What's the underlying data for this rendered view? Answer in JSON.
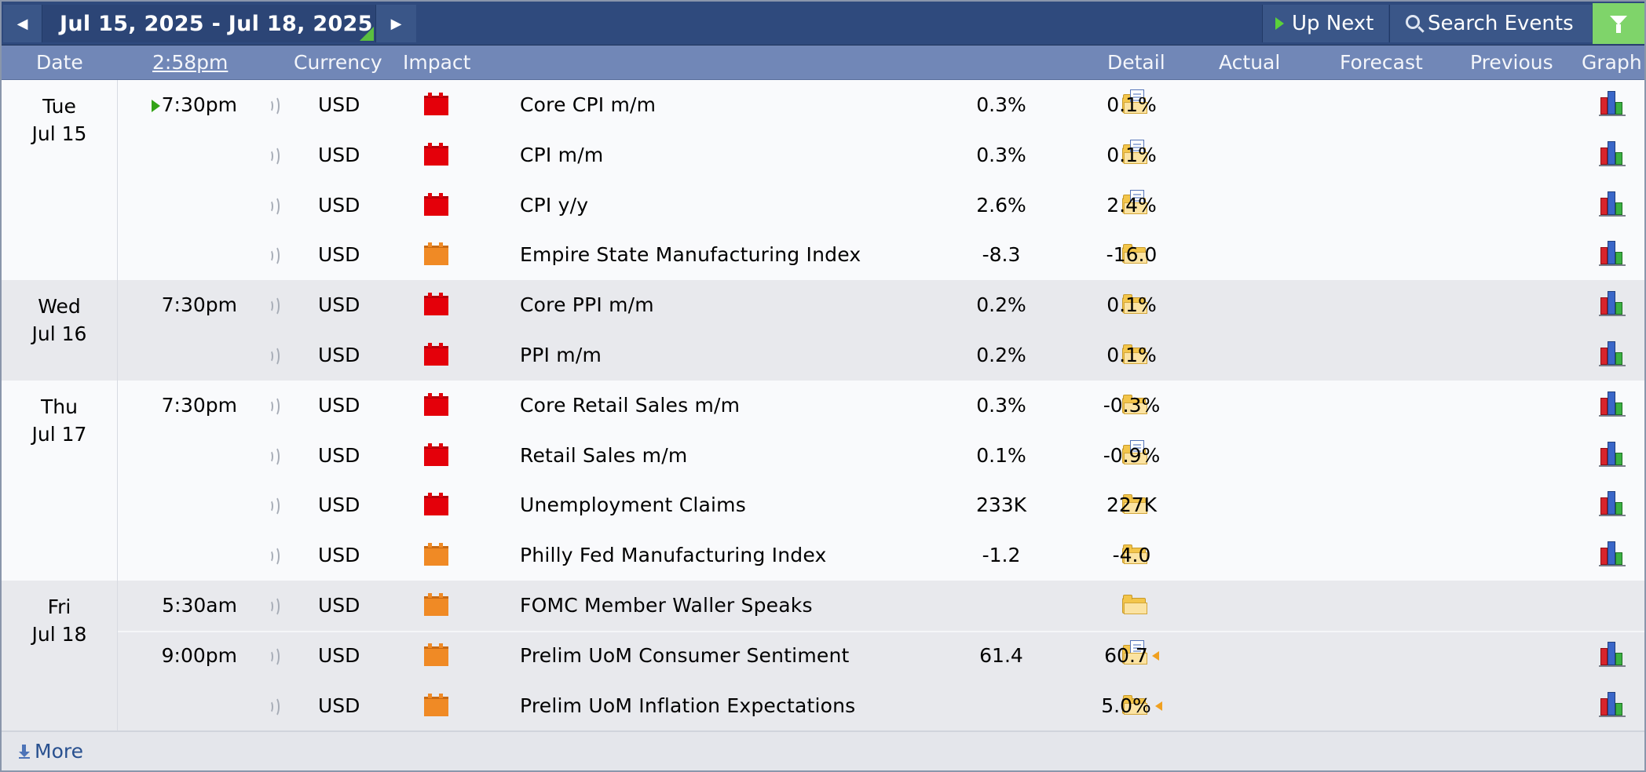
{
  "nav": {
    "date_range": "Jul 15, 2025 - Jul 18, 2025",
    "up_next": "Up Next",
    "search": "Search Events"
  },
  "header": {
    "date": "Date",
    "time": "2:58pm",
    "currency": "Currency",
    "impact": "Impact",
    "detail": "Detail",
    "actual": "Actual",
    "forecast": "Forecast",
    "previous": "Previous",
    "graph": "Graph"
  },
  "days": [
    {
      "day": "Tue",
      "date": "Jul 15",
      "events": [
        {
          "time": "7:30pm",
          "now": true,
          "currency": "USD",
          "impact": "high",
          "event": "Core CPI m/m",
          "detail": "docs",
          "actual": "",
          "forecast": "0.3%",
          "previous": "0.1%",
          "revised": false,
          "graph": true
        },
        {
          "time": "",
          "currency": "USD",
          "impact": "high",
          "event": "CPI m/m",
          "detail": "docs",
          "actual": "",
          "forecast": "0.3%",
          "previous": "0.1%",
          "revised": false,
          "graph": true
        },
        {
          "time": "",
          "currency": "USD",
          "impact": "high",
          "event": "CPI y/y",
          "detail": "docs",
          "actual": "",
          "forecast": "2.6%",
          "previous": "2.4%",
          "revised": false,
          "graph": true
        },
        {
          "time": "",
          "currency": "USD",
          "impact": "medium",
          "event": "Empire State Manufacturing Index",
          "detail": "folder",
          "actual": "",
          "forecast": "-8.3",
          "previous": "-16.0",
          "revised": false,
          "graph": true
        }
      ]
    },
    {
      "day": "Wed",
      "date": "Jul 16",
      "events": [
        {
          "time": "7:30pm",
          "currency": "USD",
          "impact": "high",
          "event": "Core PPI m/m",
          "detail": "folder",
          "actual": "",
          "forecast": "0.2%",
          "previous": "0.1%",
          "revised": false,
          "graph": true
        },
        {
          "time": "",
          "currency": "USD",
          "impact": "high",
          "event": "PPI m/m",
          "detail": "folder",
          "actual": "",
          "forecast": "0.2%",
          "previous": "0.1%",
          "revised": false,
          "graph": true
        }
      ]
    },
    {
      "day": "Thu",
      "date": "Jul 17",
      "events": [
        {
          "time": "7:30pm",
          "currency": "USD",
          "impact": "high",
          "event": "Core Retail Sales m/m",
          "detail": "folder",
          "actual": "",
          "forecast": "0.3%",
          "previous": "-0.3%",
          "revised": false,
          "graph": true
        },
        {
          "time": "",
          "currency": "USD",
          "impact": "high",
          "event": "Retail Sales m/m",
          "detail": "docs",
          "actual": "",
          "forecast": "0.1%",
          "previous": "-0.9%",
          "revised": false,
          "graph": true
        },
        {
          "time": "",
          "currency": "USD",
          "impact": "high",
          "event": "Unemployment Claims",
          "detail": "folder",
          "actual": "",
          "forecast": "233K",
          "previous": "227K",
          "revised": false,
          "graph": true
        },
        {
          "time": "",
          "currency": "USD",
          "impact": "medium",
          "event": "Philly Fed Manufacturing Index",
          "detail": "folder",
          "actual": "",
          "forecast": "-1.2",
          "previous": "-4.0",
          "revised": false,
          "graph": true
        }
      ]
    },
    {
      "day": "Fri",
      "date": "Jul 18",
      "events": [
        {
          "time": "5:30am",
          "currency": "USD",
          "impact": "medium",
          "event": "FOMC Member Waller Speaks",
          "detail": "folder",
          "actual": "",
          "forecast": "",
          "previous": "",
          "revised": false,
          "graph": false
        },
        {
          "time": "9:00pm",
          "currency": "USD",
          "impact": "medium",
          "event": "Prelim UoM Consumer Sentiment",
          "detail": "docs",
          "actual": "",
          "forecast": "61.4",
          "previous": "60.7",
          "revised": true,
          "graph": true
        },
        {
          "time": "",
          "currency": "USD",
          "impact": "medium",
          "event": "Prelim UoM Inflation Expectations",
          "detail": "folder",
          "actual": "",
          "forecast": "",
          "previous": "5.0%",
          "revised": true,
          "graph": true
        }
      ]
    }
  ],
  "footer": {
    "more": "More"
  },
  "colors": {
    "nav_bg": "#2f4a7d",
    "header_bg": "#7187b7",
    "impact_high": "#e4000a",
    "impact_medium": "#f08a25",
    "filter_bg": "#7fd46a"
  }
}
